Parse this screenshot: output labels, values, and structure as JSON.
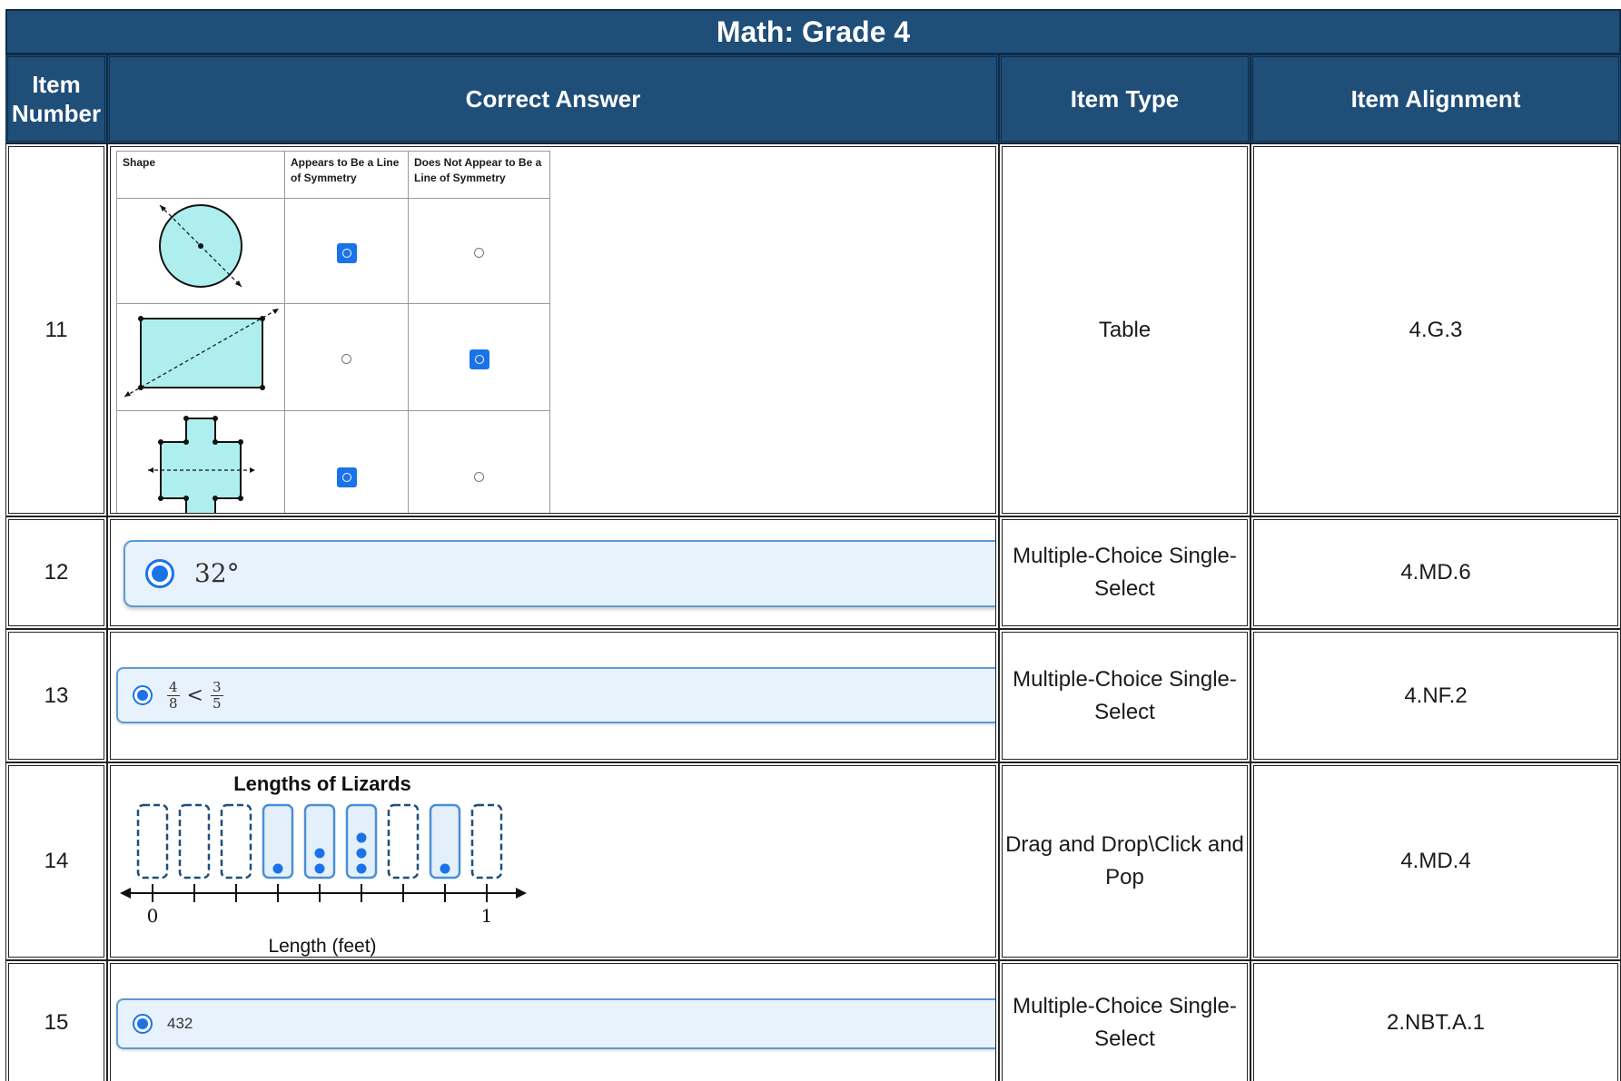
{
  "title": "Math: Grade 4",
  "headers": {
    "item_number": "Item Number",
    "correct_answer": "Correct Answer",
    "item_type": "Item Type",
    "item_alignment": "Item Alignment"
  },
  "colors": {
    "header_bg": "#1f4e79",
    "select_blue": "#1a73e8",
    "shape_fill": "#aeeeee"
  },
  "rows": [
    {
      "number": "11",
      "item_type": "Table",
      "alignment": "4.G.3",
      "answer": {
        "table_headers": {
          "shape": "Shape",
          "appears": "Appears to Be a Line of Symmetry",
          "not_appears": "Does Not Appear to Be a Line of Symmetry"
        },
        "shapes": [
          {
            "shape": "circle",
            "selected": "appears"
          },
          {
            "shape": "rectangle",
            "selected": "not_appears"
          },
          {
            "shape": "cross",
            "selected": "appears"
          }
        ]
      }
    },
    {
      "number": "12",
      "item_type": "Multiple-Choice Single-Select",
      "alignment": "4.MD.6",
      "answer": {
        "value": "32°"
      }
    },
    {
      "number": "13",
      "item_type": "Multiple-Choice Single-Select",
      "alignment": "4.NF.2",
      "answer": {
        "left_num": "4",
        "left_den": "8",
        "operator": "<",
        "right_num": "3",
        "right_den": "5"
      }
    },
    {
      "number": "14",
      "item_type": "Drag and Drop\\Click and Pop",
      "alignment": "4.MD.4",
      "answer": {
        "plot_title": "Lengths of Lizards",
        "xlabel": "Length (feet)",
        "tick_start": "0",
        "tick_end": "1",
        "dot_counts": [
          0,
          0,
          0,
          1,
          2,
          3,
          0,
          1,
          0
        ]
      }
    },
    {
      "number": "15",
      "item_type": "Multiple-Choice Single-Select",
      "alignment": "2.NBT.A.1",
      "answer": {
        "value": "432"
      }
    }
  ]
}
